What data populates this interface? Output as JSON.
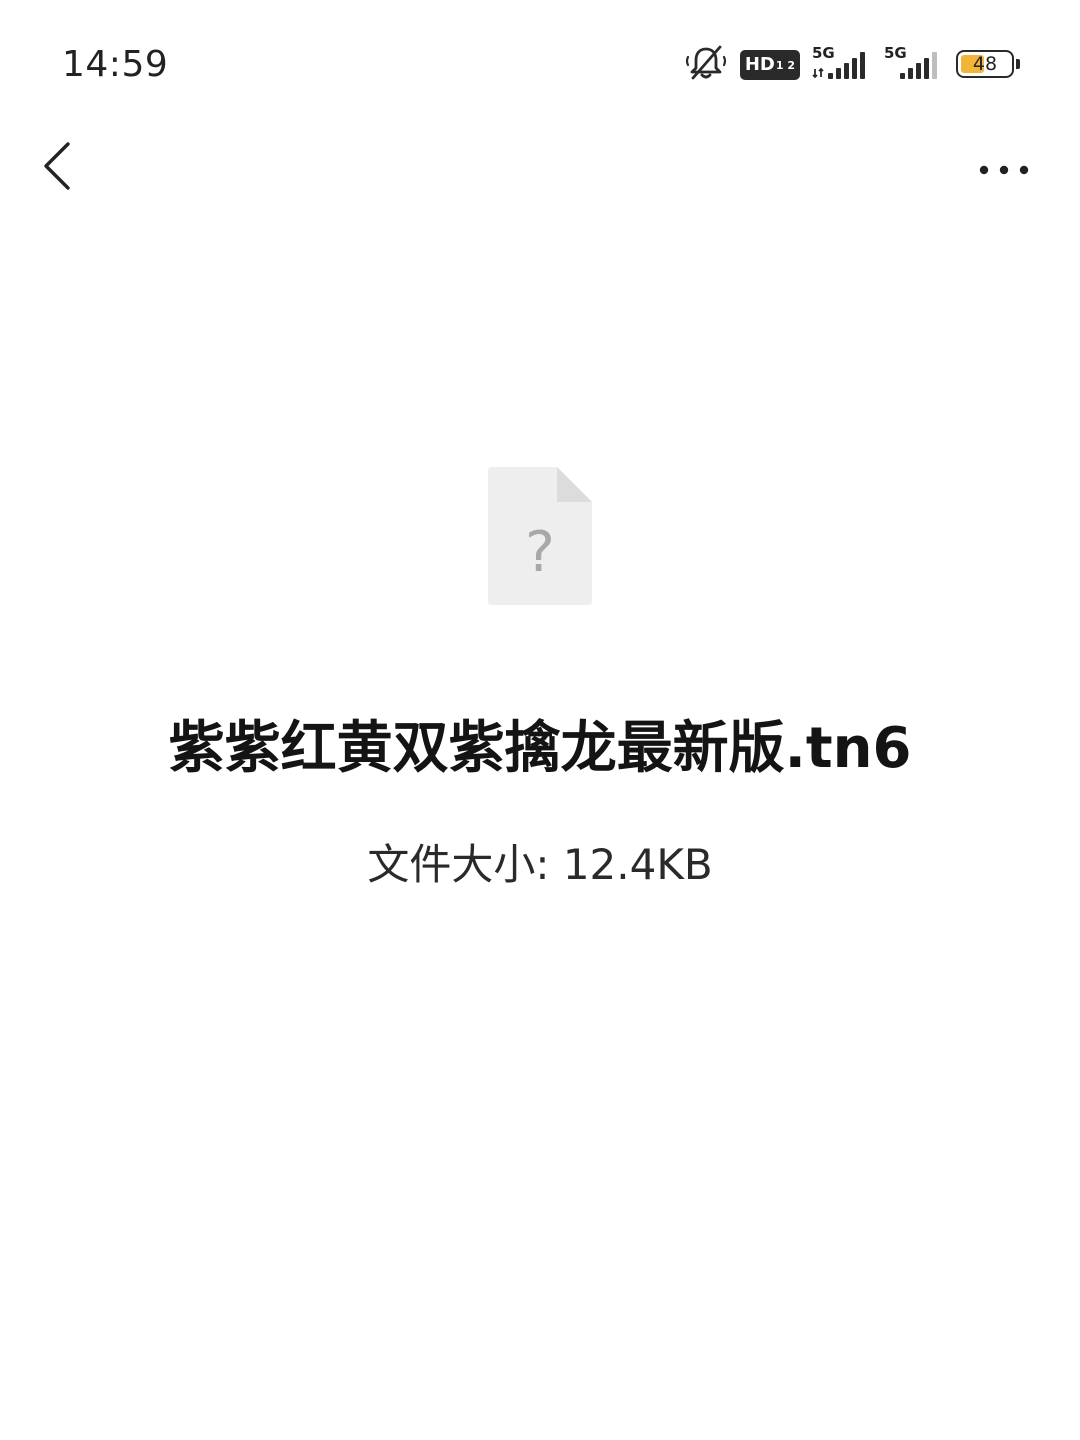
{
  "status_bar": {
    "time": "14:59",
    "icons": [
      "mute-icon",
      "hd-voice-icon",
      "signal-icon",
      "signal-icon",
      "battery-icon"
    ],
    "hd_label": "HD",
    "hd_sub": "1 2",
    "sim1_network": "5G",
    "sim2_network": "5G",
    "battery_level": "48",
    "battery_fraction": 0.48,
    "battery_color": "#f2b53a"
  },
  "nav": {
    "back_icon": "chevron-left-icon",
    "more_icon": "more-horizontal-icon"
  },
  "file": {
    "icon": "unknown-file-icon",
    "icon_glyph": "?",
    "name": "紫紫红黄双紫擒龙最新版.tn6",
    "size_text": "文件大小: 12.4KB"
  },
  "colors": {
    "background": "#ffffff",
    "file_icon": "#eeeeee",
    "file_icon_fold": "#dcdcdc",
    "file_icon_glyph": "#a8a8a8"
  }
}
